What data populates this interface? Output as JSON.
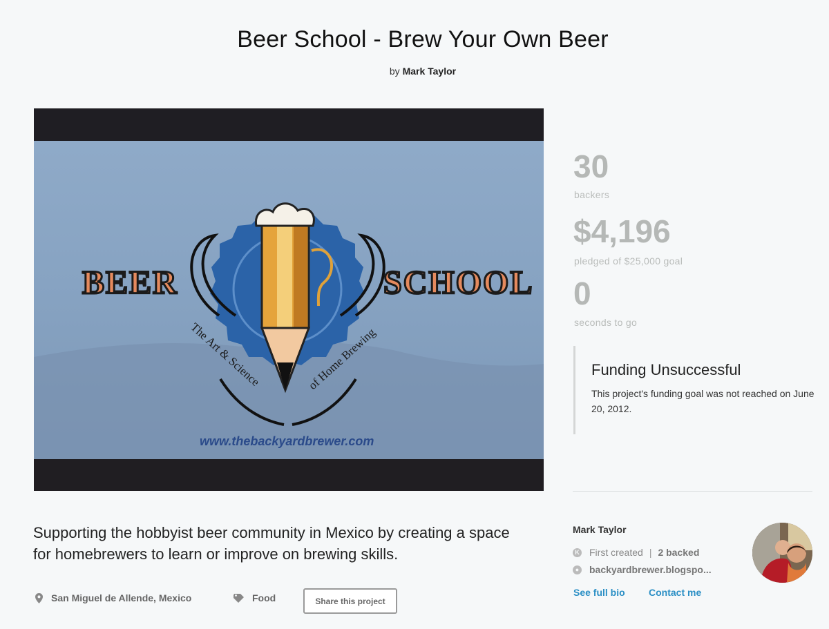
{
  "project": {
    "title": "Beer School - Brew Your Own Beer",
    "by_prefix": "by",
    "creator": "Mark Taylor"
  },
  "video": {
    "logo_left": "BEER",
    "logo_right": "SCHOOL",
    "tagline_left": "The Art & Science",
    "tagline_right": "of Home Brewing",
    "url": "www.thebackyardbrewer.com"
  },
  "stats": {
    "backers": "30",
    "backers_label": "backers",
    "pledged": "$4,196",
    "pledged_label": "pledged of $25,000 goal",
    "time_left": "0",
    "time_label": "seconds to go"
  },
  "funding": {
    "title": "Funding Unsuccessful",
    "message": "This project's funding goal was not reached on June 20, 2012."
  },
  "blurb": "Supporting the hobbyist beer community in Mexico by creating a space for homebrewers to learn or improve on brewing skills.",
  "meta": {
    "location": "San Miguel de Allende, Mexico",
    "category": "Food",
    "share_label": "Share this project"
  },
  "creator_card": {
    "name": "Mark Taylor",
    "first_created": "First created",
    "separator": "|",
    "backed": "2 backed",
    "website": "backyardbrewer.blogspo...",
    "see_bio": "See full bio",
    "contact": "Contact me"
  },
  "colors": {
    "link": "#2b8fc5",
    "stat_gray": "#b5b8b6",
    "video_bg": "#8faac8"
  }
}
